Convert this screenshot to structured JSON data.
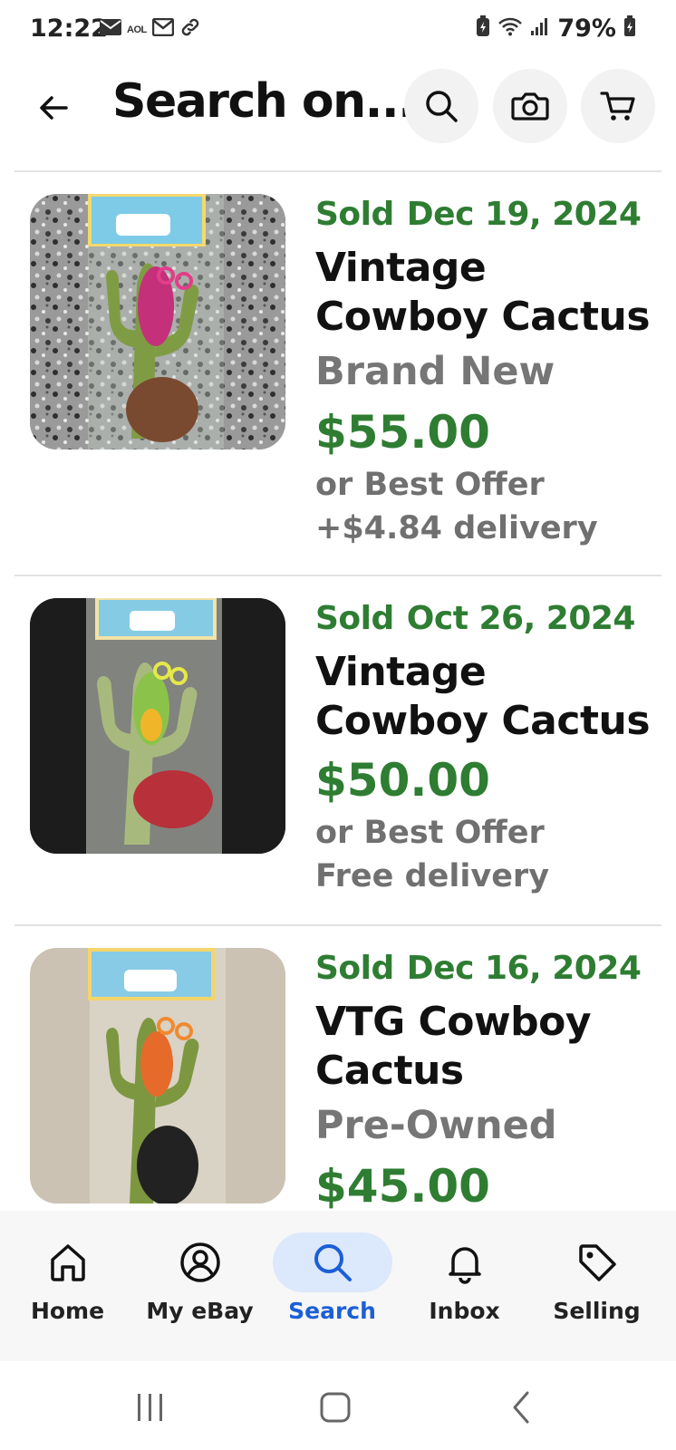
{
  "status_bar": {
    "time": "12:22",
    "aol_label": "AOL",
    "battery_text": "79%",
    "icons": [
      "mail-icon",
      "aol-icon",
      "mail-outline-icon",
      "link-icon",
      "battery-saver-icon",
      "wifi-icon",
      "signal-icon",
      "battery-icon"
    ]
  },
  "header": {
    "title": "Search on...",
    "back_icon": "back-arrow-icon",
    "search_icon": "search-icon",
    "camera_icon": "camera-icon",
    "cart_icon": "cart-icon"
  },
  "listings": [
    {
      "sold_label": "Sold",
      "sold_date": "Dec 19, 2024",
      "title_line1": "Vintage",
      "title_line2": "Cowboy Cactus",
      "condition": "Brand New",
      "price": "$55.00",
      "offer": "or Best Offer",
      "delivery": "+$4.84 delivery"
    },
    {
      "sold_label": "Sold",
      "sold_date": "Oct 26, 2024",
      "title_line1": "Vintage",
      "title_line2": "Cowboy Cactus",
      "condition": "",
      "price": "$50.00",
      "offer": "or Best Offer",
      "delivery": "Free delivery"
    },
    {
      "sold_label": "Sold",
      "sold_date": "Dec 16, 2024",
      "title_line1": "VTG Cowboy",
      "title_line2": "Cactus",
      "condition": "Pre-Owned",
      "price": "$45.00",
      "offer": "",
      "delivery": ""
    }
  ],
  "bottom_nav": {
    "items": [
      {
        "label": "Home",
        "icon": "home-icon"
      },
      {
        "label": "My eBay",
        "icon": "account-icon"
      },
      {
        "label": "Search",
        "icon": "search-icon",
        "active": true
      },
      {
        "label": "Inbox",
        "icon": "bell-icon"
      },
      {
        "label": "Selling",
        "icon": "tag-icon"
      }
    ]
  },
  "colors": {
    "sold_green": "#2e7d32",
    "active_blue": "#1b5fd6",
    "active_pill": "#dce8fb",
    "muted_gray": "#767676"
  }
}
